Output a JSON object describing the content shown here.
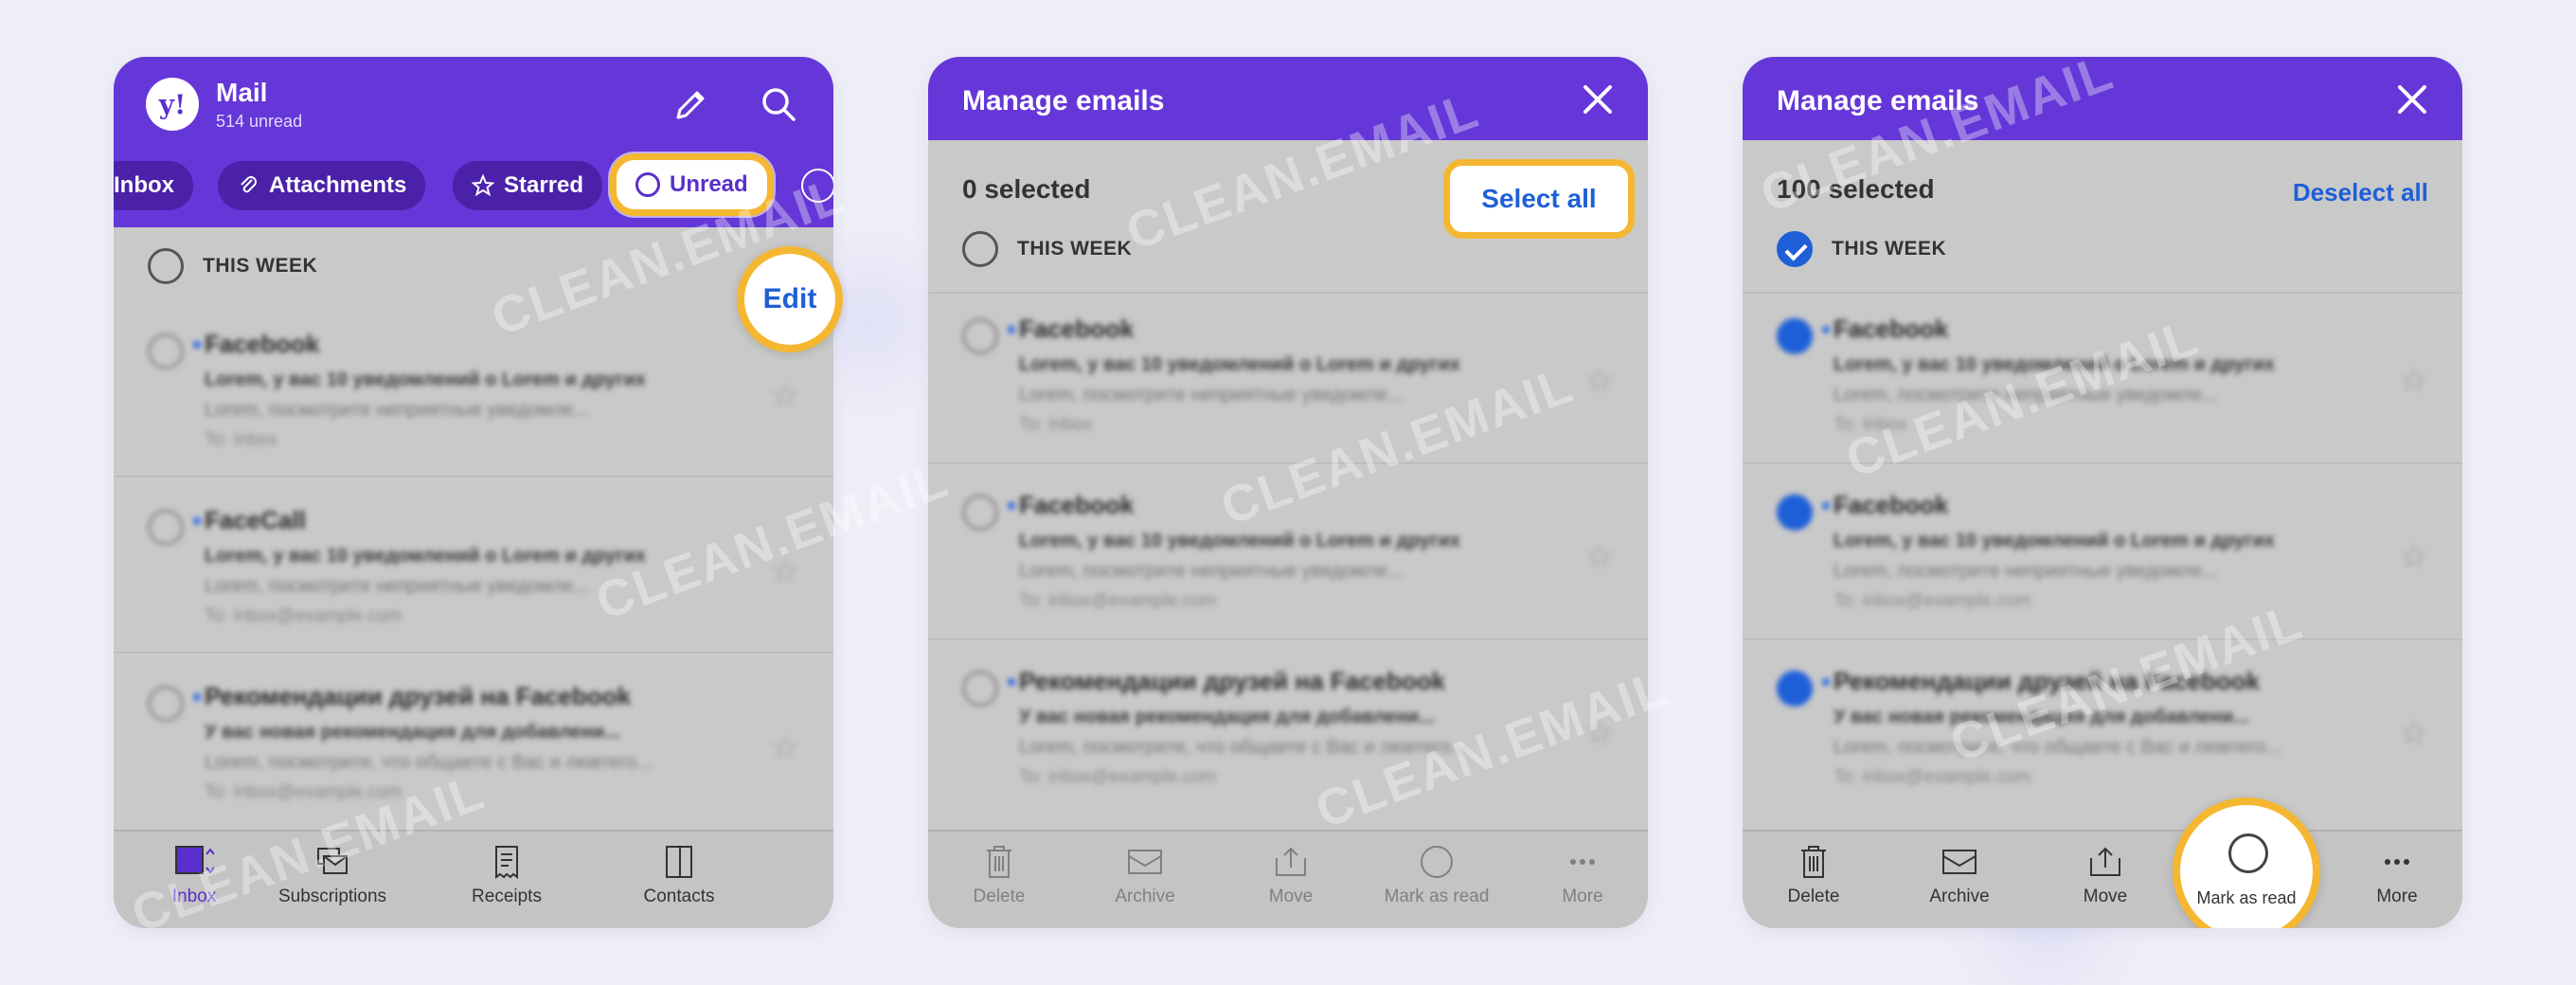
{
  "watermark_text": "CLEAN.EMAIL",
  "colors": {
    "brand": "#6537d8",
    "highlight": "#f5b731",
    "link": "#1e5fd8"
  },
  "panel1": {
    "app_title": "Mail",
    "unread_count": "514 unread",
    "filters": [
      {
        "label": "Inbox",
        "icon": ""
      },
      {
        "label": "Attachments",
        "icon": "paperclip-icon"
      },
      {
        "label": "Starred",
        "icon": "star-icon"
      },
      {
        "label": "Unread",
        "icon": "circle-icon"
      }
    ],
    "section_label": "THIS WEEK",
    "edit_label": "Edit",
    "emails": [
      {
        "sender": "Facebook",
        "subject": "Lorem, y вас 10 уведомлений о Lorem и других",
        "preview": "Lorem, посмотрите неприятные уведомле...",
        "to": "To: Inbox"
      },
      {
        "sender": "FaceCall",
        "subject": "Lorem, y вас 10 уведомлений о Lorem и других",
        "preview": "Lorem, посмотрите неприятные уведомле...",
        "to": "To: inbox@example.com"
      },
      {
        "sender": "Рекомендации друзей на Facebook",
        "subject": "У вас новая рекомендация для добавлени...",
        "preview": "Lorem, посмотрите, что общаете с Вас и лювтего...",
        "to": "To: inbox@example.com"
      }
    ],
    "nav": [
      "Inbox",
      "Subscriptions",
      "Receipts",
      "Contacts"
    ]
  },
  "panel2": {
    "title": "Manage emails",
    "selected": "0 selected",
    "select_all": "Select all",
    "section_label": "THIS WEEK",
    "emails": [
      {
        "sender": "Facebook",
        "subject": "Lorem, y вас 10 уведомлений о Lorem и других",
        "preview": "Lorem, посмотрите неприятные уведомле...",
        "to": "To: Inbox"
      },
      {
        "sender": "Facebook",
        "subject": "Lorem, y вас 10 уведомлений о Lorem и других",
        "preview": "Lorem, посмотрите неприятные уведомле...",
        "to": "To: inbox@example.com"
      },
      {
        "sender": "Рекомендации друзей на Facebook",
        "subject": "У вас новая рекомендация для добавлени...",
        "preview": "Lorem, посмотрите, что общаете с Вас и лювтего...",
        "to": "To: inbox@example.com"
      }
    ],
    "actions": [
      "Delete",
      "Archive",
      "Move",
      "Mark as read",
      "More"
    ]
  },
  "panel3": {
    "title": "Manage emails",
    "selected": "100 selected",
    "deselect_all": "Deselect all",
    "section_label": "THIS WEEK",
    "emails": [
      {
        "sender": "Facebook",
        "subject": "Lorem, y вас 10 уведомлений о Lorem и других",
        "preview": "Lorem, посмотрите неприятные уведомле...",
        "to": "To: Inbox"
      },
      {
        "sender": "Facebook",
        "subject": "Lorem, y вас 10 уведомлений о Lorem и других",
        "preview": "Lorem, посмотрите неприятные уведомле...",
        "to": "To: inbox@example.com"
      },
      {
        "sender": "Рекомендации друзей на Facebook",
        "subject": "У вас новая рекомендация для добавлени...",
        "preview": "Lorem, посмотрите, что общаете с Вас и лювтего...",
        "to": "To: inbox@example.com"
      }
    ],
    "actions": [
      "Delete",
      "Archive",
      "Move",
      "Mark as read",
      "More"
    ]
  }
}
